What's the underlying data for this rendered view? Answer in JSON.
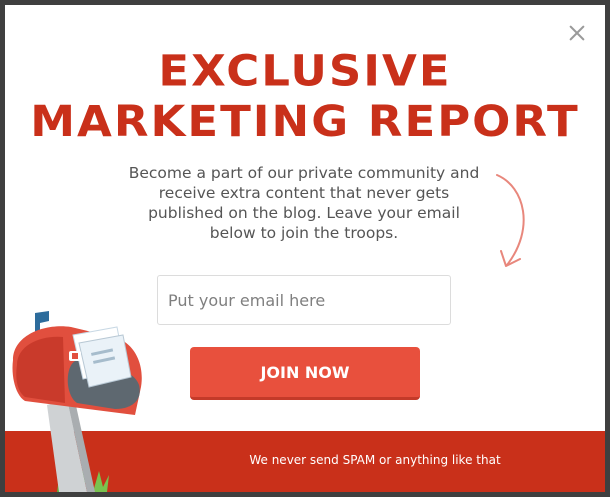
{
  "popup": {
    "title_line1": "EXCLUSIVE",
    "title_line2": "MARKETING REPORT",
    "description": "Become a part of our private community and receive extra content that never gets published on the blog. Leave your email below to join the troops.",
    "email_placeholder": "Put your email here",
    "join_label": "JOIN NOW",
    "footer_text": "We never send SPAM or anything like that"
  },
  "colors": {
    "title": "#c9301a",
    "button": "#e8503d",
    "footer": "#c9301a",
    "backdrop": "#3f3f3f"
  },
  "icons": [
    "close-icon",
    "arrow-icon",
    "mailbox-illustration"
  ]
}
